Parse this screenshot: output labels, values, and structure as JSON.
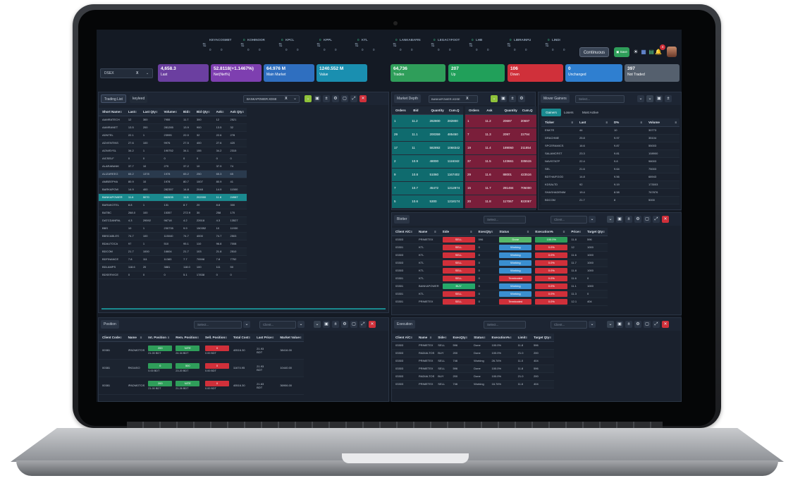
{
  "tickers": [
    {
      "name": "KEYACOSMET",
      "change": "0",
      "a": "0",
      "b": "0"
    },
    {
      "name": "KOHINOOR",
      "change": "0",
      "a": "0",
      "b": "0"
    },
    {
      "name": "KPCL",
      "change": "0",
      "a": "0",
      "b": "0"
    },
    {
      "name": "KPPL",
      "change": "0",
      "a": "0",
      "b": "0"
    },
    {
      "name": "KTL",
      "change": "0",
      "a": "0",
      "b": "0"
    },
    {
      "name": "LANKABAFIN",
      "change": "0",
      "a": "0",
      "b": "0"
    },
    {
      "name": "LEGACYFOOT",
      "change": "0",
      "a": "0",
      "b": "0"
    },
    {
      "name": "LHB",
      "change": "0",
      "a": "0",
      "b": "0"
    },
    {
      "name": "LIBRAINFU",
      "change": "0",
      "a": "0",
      "b": "0"
    },
    {
      "name": "LINDI",
      "change": "",
      "a": "0",
      "b": "0"
    }
  ],
  "header": {
    "continuous": "Continuous",
    "save": "Save",
    "notif_count": "4"
  },
  "exchange": {
    "value": "DSEX",
    "clear": "X"
  },
  "tiles": [
    {
      "value": "4,658.3",
      "label": "Last",
      "color": "#6b3fa0"
    },
    {
      "value": "52.8118(+1.1467%)",
      "label": "Net(Net%)",
      "color": "#7e3fb0"
    },
    {
      "value": "64.976 M",
      "label": "Main Market",
      "color": "#2f6fc0"
    },
    {
      "value": "1240.552 M",
      "label": "Value",
      "color": "#1a8fb0"
    },
    {
      "value": "64,736",
      "label": "Trades",
      "color": "#2f9e5a"
    },
    {
      "value": "207",
      "label": "Up",
      "color": "#21a05a"
    },
    {
      "value": "106",
      "label": "Down",
      "color": "#d0303a"
    },
    {
      "value": "0",
      "label": "Unchanged",
      "color": "#2f7fd0"
    },
    {
      "value": "397",
      "label": "Not Traded",
      "color": "#55606e"
    }
  ],
  "trading": {
    "tabs": [
      "Trading List",
      "keyleed"
    ],
    "instrument": "BANKAPOWER.XDSE",
    "cols": [
      "Short Name",
      "Last",
      "Last Qty",
      "Volume",
      "Bid",
      "Bid Qty",
      "Ask",
      "Ask Qty"
    ],
    "rows": [
      [
        "AAMRATECH",
        "12",
        "300",
        "7955",
        "11.7",
        "300",
        "12",
        "2521"
      ],
      [
        "AAMRANET",
        "13.5",
        "200",
        "281285",
        "13.9",
        "900",
        "13.5",
        "32"
      ],
      [
        "ADNTEL",
        "22.1",
        "1",
        "23995",
        "22.0",
        "32",
        "22.6",
        "278"
      ],
      [
        "ADVENTINS",
        "27.6",
        "100",
        "9976",
        "27.5",
        "400",
        "27.6",
        "420"
      ],
      [
        "AGNISYSL",
        "34.2",
        "1",
        "190752",
        "34.1",
        "155",
        "34.2",
        "2315"
      ],
      [
        "AICSELF",
        "0",
        "0",
        "0",
        "0",
        "0",
        "0",
        "0"
      ],
      [
        "ALARABANK",
        "37.7",
        "10",
        "270",
        "37.2",
        "10",
        "37.9",
        "74"
      ],
      [
        "ALIZAREEG",
        "65.2",
        "1378",
        "1978",
        "65.2",
        "250",
        "65.3",
        "65"
      ],
      [
        "AMBEEPHA",
        "80.9",
        "10",
        "1978",
        "80.7",
        "1007",
        "80.9",
        "41"
      ],
      [
        "BARKAPOW",
        "14.9",
        "400",
        "282357",
        "14.8",
        "2048",
        "14.9",
        "11500"
      ],
      [
        "BANKAPOWER",
        "11.6",
        "5070",
        "662635",
        "11.5",
        "202000",
        "11.6",
        "24987"
      ],
      [
        "BARAKOTEL",
        "8.8",
        "1",
        "131",
        "8.7",
        "20",
        "8.8",
        "300"
      ],
      [
        "BATBC",
        "268.0",
        "100",
        "15357",
        "272.9",
        "30",
        "258",
        "170"
      ],
      [
        "DATCDANPAL",
        "4.3",
        "29592",
        "96718",
        "4.2",
        "22618",
        "4.3",
        "13527"
      ],
      [
        "BBS",
        "10",
        "1",
        "230735",
        "9.9",
        "150352",
        "10",
        "11930"
      ],
      [
        "BBSCABLES",
        "74.7",
        "100",
        "115040",
        "74.7",
        "4000",
        "74.7",
        "2503"
      ],
      [
        "BDAUTOCA",
        "97",
        "1",
        "510",
        "95.1",
        "110",
        "96.8",
        "7008"
      ],
      [
        "BDCOM",
        "21.7",
        "1000",
        "16604",
        "21.7",
        "103",
        "21.8",
        "2510"
      ],
      [
        "BDFINANCE",
        "7.8",
        "111",
        "11383",
        "7.7",
        "70598",
        "7.8",
        "7752"
      ],
      [
        "BDLAMPS",
        "118.6",
        "20",
        "3881",
        "118.0",
        "100",
        "111",
        "50"
      ],
      [
        "BDSERVICE",
        "0",
        "0",
        "0",
        "5.1",
        "17838",
        "0",
        "0"
      ]
    ]
  },
  "depth": {
    "tab": "Market Depth",
    "instrument": "BANKAPOWER.XDSE",
    "buy_cols": [
      "Orders",
      "Bid",
      "Quantity",
      "Cum.Q"
    ],
    "sell_cols": [
      "Orders",
      "Ask",
      "Quantity",
      "Cum.Q"
    ],
    "buy": [
      [
        "1",
        "11.2",
        "282800",
        "282800"
      ],
      [
        "29",
        "11.1",
        "200359",
        "485450"
      ],
      [
        "17",
        "11",
        "582892",
        "1068342"
      ],
      [
        "2",
        "10.9",
        "48000",
        "1116342"
      ],
      [
        "9",
        "10.8",
        "51060",
        "1167402"
      ],
      [
        "7",
        "10.7",
        "45472",
        "1212874"
      ],
      [
        "5",
        "10.6",
        "5300",
        "1218174"
      ]
    ],
    "sell": [
      [
        "1",
        "11.2",
        "20697",
        "20697"
      ],
      [
        "7",
        "11.3",
        "2097",
        "22794"
      ],
      [
        "19",
        "11.4",
        "189060",
        "211854"
      ],
      [
        "37",
        "11.5",
        "123661",
        "335515"
      ],
      [
        "29",
        "11.6",
        "88001",
        "423516"
      ],
      [
        "15",
        "11.7",
        "281484",
        "705000"
      ],
      [
        "20",
        "11.8",
        "117067",
        "822067"
      ]
    ]
  },
  "movers": {
    "tab": "Mover Gainers",
    "select": "Select...",
    "subtabs": [
      "Gainers",
      "Losers",
      "Most Active"
    ],
    "cols": [
      "Ticker",
      "Last",
      "D%",
      "Volume"
    ],
    "rows": [
      [
        "ENKTE",
        "44",
        "10",
        "30773"
      ],
      [
        "DRACHME",
        "25.8",
        "9.97",
        "35104"
      ],
      [
        "SPCERAMICS",
        "16.6",
        "9.87",
        "55003"
      ],
      [
        "SALAMCRST",
        "23.3",
        "9.81",
        "108900"
      ],
      [
        "NAVISTATP",
        "22.4",
        "9.8",
        "98003"
      ],
      [
        "SEL",
        "21.6",
        "9.64",
        "75003"
      ],
      [
        "BDTHAIFOOD",
        "14.8",
        "9.56",
        "68943"
      ],
      [
        "KDSALTD",
        "92",
        "9.19",
        "173003"
      ],
      [
        "SHASHADENIM",
        "19.4",
        "8.58",
        "767876"
      ],
      [
        "BDCOM",
        "21.7",
        "8",
        "5000"
      ]
    ]
  },
  "blotter": {
    "tab": "Blotter",
    "select1": "Select...",
    "select2": "Client...",
    "cols": [
      "Client A/C",
      "Name",
      "Side",
      "ExecQty",
      "Status",
      "Execution%",
      "Price",
      "Target Qty"
    ],
    "rows": [
      [
        "03303",
        "PRIMETEX",
        "SELL",
        "596",
        "Done",
        "100.0%",
        "11.8",
        "596"
      ],
      [
        "03301",
        "KTL",
        "SELL",
        "0",
        "Working",
        "0.0%",
        "12",
        "1000"
      ],
      [
        "03303",
        "KTL",
        "SELL",
        "0",
        "Working",
        "0.0%",
        "11.6",
        "1000"
      ],
      [
        "03303",
        "KTL",
        "SELL",
        "0",
        "Working",
        "0.0%",
        "11.7",
        "1000"
      ],
      [
        "03303",
        "KTL",
        "SELL",
        "0",
        "Working",
        "0.0%",
        "11.8",
        "1000"
      ],
      [
        "03301",
        "KTL",
        "SELL",
        "0",
        "Terminated",
        "0.0%",
        "11.6",
        "0"
      ],
      [
        "03301",
        "BANKAPOWER",
        "BUY",
        "0",
        "Working",
        "0.0%",
        "11.1",
        "1000"
      ],
      [
        "03301",
        "KTL",
        "SELL",
        "0",
        "Working",
        "0.0%",
        "11.3",
        "0"
      ],
      [
        "03301",
        "PRIMETEX",
        "SELL",
        "0",
        "Terminated",
        "0.0%",
        "12.1",
        "404"
      ]
    ]
  },
  "position": {
    "tab": "Position",
    "select1": "Select...",
    "select2": "Client...",
    "cols": [
      "Client Code",
      "Name",
      "Int. Position",
      "Rem. Position",
      "Sell. Position",
      "Total Cost",
      "Last Price",
      "Market Value"
    ],
    "rows": [
      {
        "code": "00381",
        "name": "IPADMOTOS",
        "int": "200",
        "int_sub": "21.00 BDT",
        "rem": "NITE",
        "rem_sub": "24.34 BDT",
        "sell": "0",
        "sell_sub": "0.00 BDT",
        "cost": "40516.30",
        "last": "21.93",
        "last_sub": "BDT",
        "mv": "38416.00"
      },
      {
        "code": "00381",
        "name": "RKDASO",
        "int": "0",
        "int_sub": "0.00 BDT",
        "rem": "500",
        "rem_sub": "23.20 BDT",
        "sell": "0",
        "sell_sub": "0.00 BDT",
        "cost": "11674.95",
        "last": "21.93",
        "last_sub": "BDT",
        "mv": "10440.00"
      },
      {
        "code": "00381",
        "name": "IPADMOTOS",
        "int": "200",
        "int_sub": "21.00 BDT",
        "rem": "NITE",
        "rem_sub": "21.26 BDT",
        "sell": "0",
        "sell_sub": "0.00 BDT",
        "cost": "40516.30",
        "last": "21.63",
        "last_sub": "BDT",
        "mv": "36906.00"
      }
    ]
  },
  "execution": {
    "tab": "Execution",
    "select1": "Select...",
    "select2": "Client...",
    "cols": [
      "Client A/C",
      "Name",
      "Side",
      "ExecQty",
      "Status",
      "Execution%",
      "Limit",
      "Target Qty"
    ],
    "rows": [
      [
        "03303",
        "PRIMETEX",
        "SELL",
        "596",
        "Done",
        "100.0%",
        "11.8",
        "596"
      ],
      [
        "03303",
        "RADIALTOS",
        "BUY",
        "200",
        "Done",
        "100.0%",
        "21.0",
        "200"
      ],
      [
        "03303",
        "PRIMETEX",
        "SELL",
        "746",
        "Working",
        "26.74%",
        "11.0",
        "404"
      ],
      [
        "03303",
        "PRIMETEX",
        "SELL",
        "596",
        "Done",
        "100.0%",
        "11.8",
        "596"
      ],
      [
        "03303",
        "RADIALTOS",
        "BUY",
        "200",
        "Done",
        "100.0%",
        "21.0",
        "200"
      ],
      [
        "03303",
        "PRIMETEX",
        "SELL",
        "746",
        "Working",
        "16.74%",
        "11.6",
        "404"
      ]
    ]
  }
}
